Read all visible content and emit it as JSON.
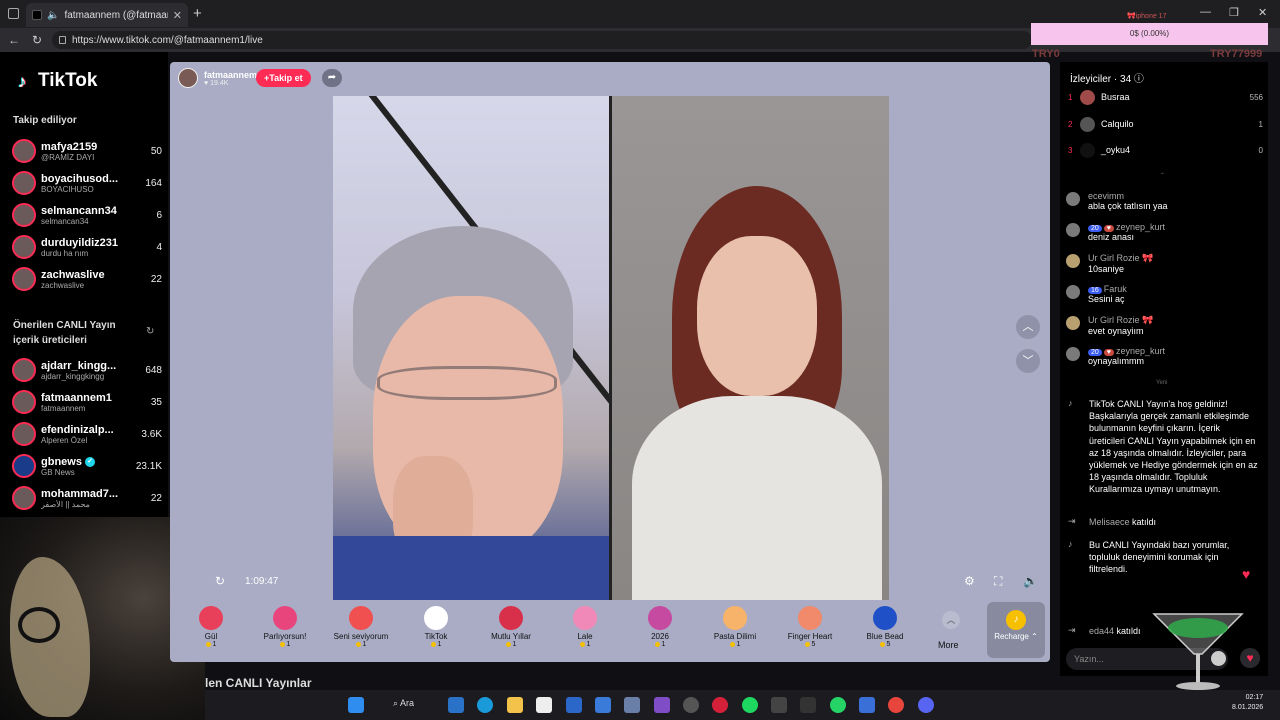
{
  "browser": {
    "tab_title": "fatmaannem (@fatmaannem",
    "url": "https://www.tiktok.com/@fatmaannem1/live"
  },
  "overlay": {
    "label": "🎀iphone 17",
    "progress_text": "0$ (0.00%)",
    "try_left": "TRY0",
    "try_right": "TRY77999"
  },
  "sidebar": {
    "logo": "TikTok",
    "following_title": "Takip ediliyor",
    "following": [
      {
        "name": "mafya2159",
        "sub": "@RAMİZ DAYI",
        "count": "50"
      },
      {
        "name": "boyacihusod...",
        "sub": "BOYACIHUSO",
        "count": "164"
      },
      {
        "name": "selmancann34",
        "sub": "selmancan34",
        "count": "6"
      },
      {
        "name": "durduyildiz231",
        "sub": "durdu ha nım",
        "count": "4"
      },
      {
        "name": "zachwaslive",
        "sub": "zachwaslive",
        "count": "22"
      }
    ],
    "suggested_title": "Önerilen CANLI Yayın içerik üreticileri",
    "suggested": [
      {
        "name": "ajdarr_kingg...",
        "sub": "ajdarr_kinggkingg",
        "count": "648"
      },
      {
        "name": "fatmaannem1",
        "sub": "fatmaannem",
        "count": "35"
      },
      {
        "name": "efendinizalp...",
        "sub": "Alperen Özel",
        "count": "3.6K"
      },
      {
        "name": "gbnews",
        "sub": "GB News",
        "count": "23.1K"
      },
      {
        "name": "mohammad7...",
        "sub": "محمد || الأصفر",
        "count": "22"
      }
    ]
  },
  "stream": {
    "host_name": "fatmaannem",
    "host_likes": "19.4K",
    "follow_label": "+Takip et",
    "timer": "1:09:47"
  },
  "gifts": [
    {
      "name": "Gül",
      "price": "1"
    },
    {
      "name": "Parlıyorsun!",
      "price": "1"
    },
    {
      "name": "Seni seviyorum",
      "price": "1"
    },
    {
      "name": "TikTok",
      "price": "1"
    },
    {
      "name": "Mutlu Yıllar",
      "price": "1"
    },
    {
      "name": "Lale",
      "price": "1"
    },
    {
      "name": "2026",
      "price": "1"
    },
    {
      "name": "Pasta Dilimi",
      "price": "1"
    },
    {
      "name": "Finger Heart",
      "price": "5"
    },
    {
      "name": "Blue Bead",
      "price": "5"
    }
  ],
  "more_label": "More",
  "recharge_label": "Recharge ⌃",
  "live_heading": "len CANLI Yayınlar",
  "viewers": {
    "title": "İzleyiciler · 34",
    "list": [
      {
        "rank": "1",
        "name": "Busraa",
        "score": "556"
      },
      {
        "rank": "2",
        "name": "Calquilo",
        "score": "1"
      },
      {
        "rank": "3",
        "name": "_oyku4",
        "score": "0"
      }
    ]
  },
  "chat": [
    {
      "badge": "",
      "user": "ecevimm",
      "text": "abla çok tatlısın yaa"
    },
    {
      "badge": "20",
      "user": "zeynep_kurt",
      "text": "deniz anası"
    },
    {
      "badge": "",
      "user": "Ur Girl Rozie 🎀",
      "text": "10saniye"
    },
    {
      "badge": "16",
      "user": "Faruk",
      "text": "Sesini aç"
    },
    {
      "badge": "",
      "user": "Ur Girl Rozie 🎀",
      "text": "evet oynayiım"
    },
    {
      "badge": "20",
      "user": "zeynep_kurt",
      "text": "oynayalımmm"
    }
  ],
  "new_sep": "Yeni",
  "welcome_msg": "TikTok CANLI Yayın'a hoş geldiniz! Başkalarıyla gerçek zamanlı etkileşimde bulunmanın keyfini çıkarın. İçerik üreticileri CANLI Yayın yapabilmek için en az 18 yaşında olmalıdır. İzleyiciler, para yüklemek ve Hediye göndermek için en az 18 yaşında olmalıdır. Topluluk Kurallarımıza uymayı unutmayın.",
  "joined1": {
    "user": "Melisaece",
    "text": "katıldı"
  },
  "filter_msg": "Bu CANLI Yayındaki bazı yorumlar, topluluk deneyimini korumak için filtrelendi.",
  "joined2": {
    "user": "eda44",
    "text": "katıldı"
  },
  "comment_placeholder": "Yazın...",
  "taskbar": {
    "search_label": "Ara",
    "time": "02:17",
    "date": "8.01.2026"
  }
}
